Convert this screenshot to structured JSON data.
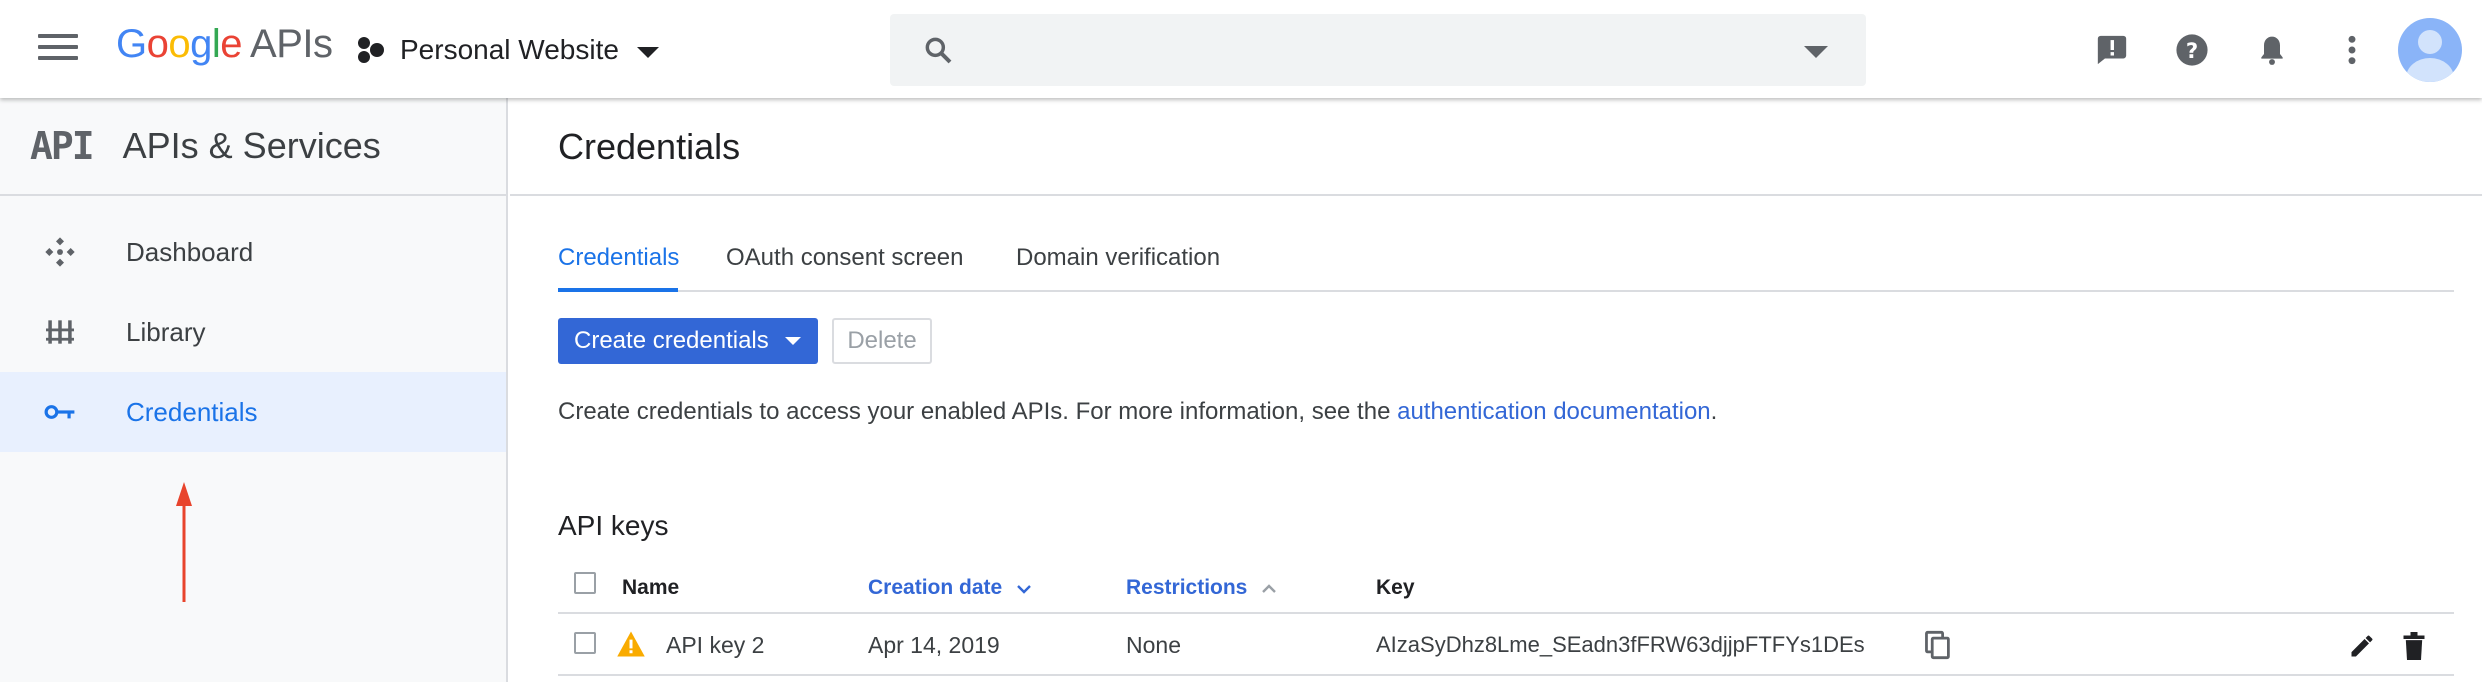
{
  "topbar": {
    "logo_google": "Google",
    "logo_apis": "APIs",
    "project_name": "Personal Website",
    "search_placeholder": ""
  },
  "sidebar": {
    "api_logo": "API",
    "title": "APIs & Services",
    "items": [
      {
        "label": "Dashboard",
        "icon": "dashboard-icon"
      },
      {
        "label": "Library",
        "icon": "library-icon"
      },
      {
        "label": "Credentials",
        "icon": "key-icon",
        "active": true
      }
    ]
  },
  "main": {
    "page_title": "Credentials",
    "tabs": [
      {
        "label": "Credentials",
        "active": true
      },
      {
        "label": "OAuth consent screen"
      },
      {
        "label": "Domain verification"
      }
    ],
    "create_button": "Create credentials",
    "delete_button": "Delete",
    "info_text": "Create credentials to access your enabled APIs. For more information, see the ",
    "info_link": "authentication documentation",
    "info_end": ".",
    "section_title": "API keys",
    "columns": [
      "Name",
      "Creation date",
      "Restrictions",
      "Key"
    ],
    "rows": [
      {
        "name": "API key 2",
        "created": "Apr 14, 2019",
        "restrictions": "None",
        "key": "AIzaSyDhz8Lme_SEadn3fFRW63djjpFTFYs1DEs"
      }
    ]
  },
  "colors": {
    "accent": "#3367d6",
    "active_item_bg": "#e8f0fe",
    "annotation_arrow": "#e8442c",
    "warning": "#f9ab00"
  }
}
